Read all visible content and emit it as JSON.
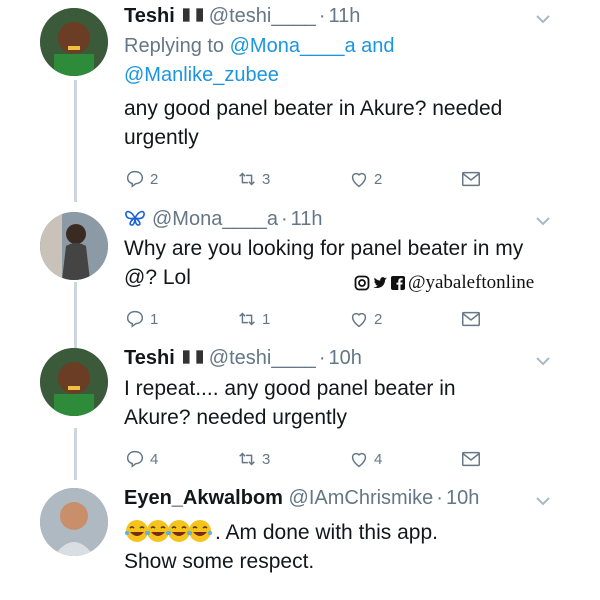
{
  "tweets": [
    {
      "name": "Teshi",
      "handle": "@teshi____",
      "time": "11h",
      "reply_prefix": "Replying to",
      "reply_user1": "@Mona____a",
      "reply_and": "and",
      "reply_user2": "@Manlike_zubee",
      "text": "any good panel beater in Akure? needed urgently",
      "replies": "2",
      "retweets": "3",
      "likes": "2"
    },
    {
      "handle": "@Mona____a",
      "time": "11h",
      "text": "Why are you looking for panel beater in my @? Lol",
      "replies": "1",
      "retweets": "1",
      "likes": "2"
    },
    {
      "name": "Teshi",
      "handle": "@teshi____",
      "time": "10h",
      "text": "I repeat.... any good panel beater in Akure? needed urgently",
      "replies": "4",
      "retweets": "3",
      "likes": "4"
    },
    {
      "name": "Eyen_Akwalbom",
      "handle": "@IAmChrismike",
      "time": "10h",
      "text": ". Am done with this app.",
      "text_line2": "Show some respect."
    }
  ],
  "watermark": {
    "text": "@yabaleftonline"
  },
  "colors": {
    "text": "#14171a",
    "secondary": "#657786",
    "link": "#1b95e0",
    "thread_line": "#ccd6dd"
  },
  "icons": [
    "reply-icon",
    "retweet-icon",
    "like-icon",
    "dm-icon",
    "chevron-down-icon",
    "nigeria-flag-icon",
    "butterfly-icon",
    "laughing-emoji-icon"
  ]
}
